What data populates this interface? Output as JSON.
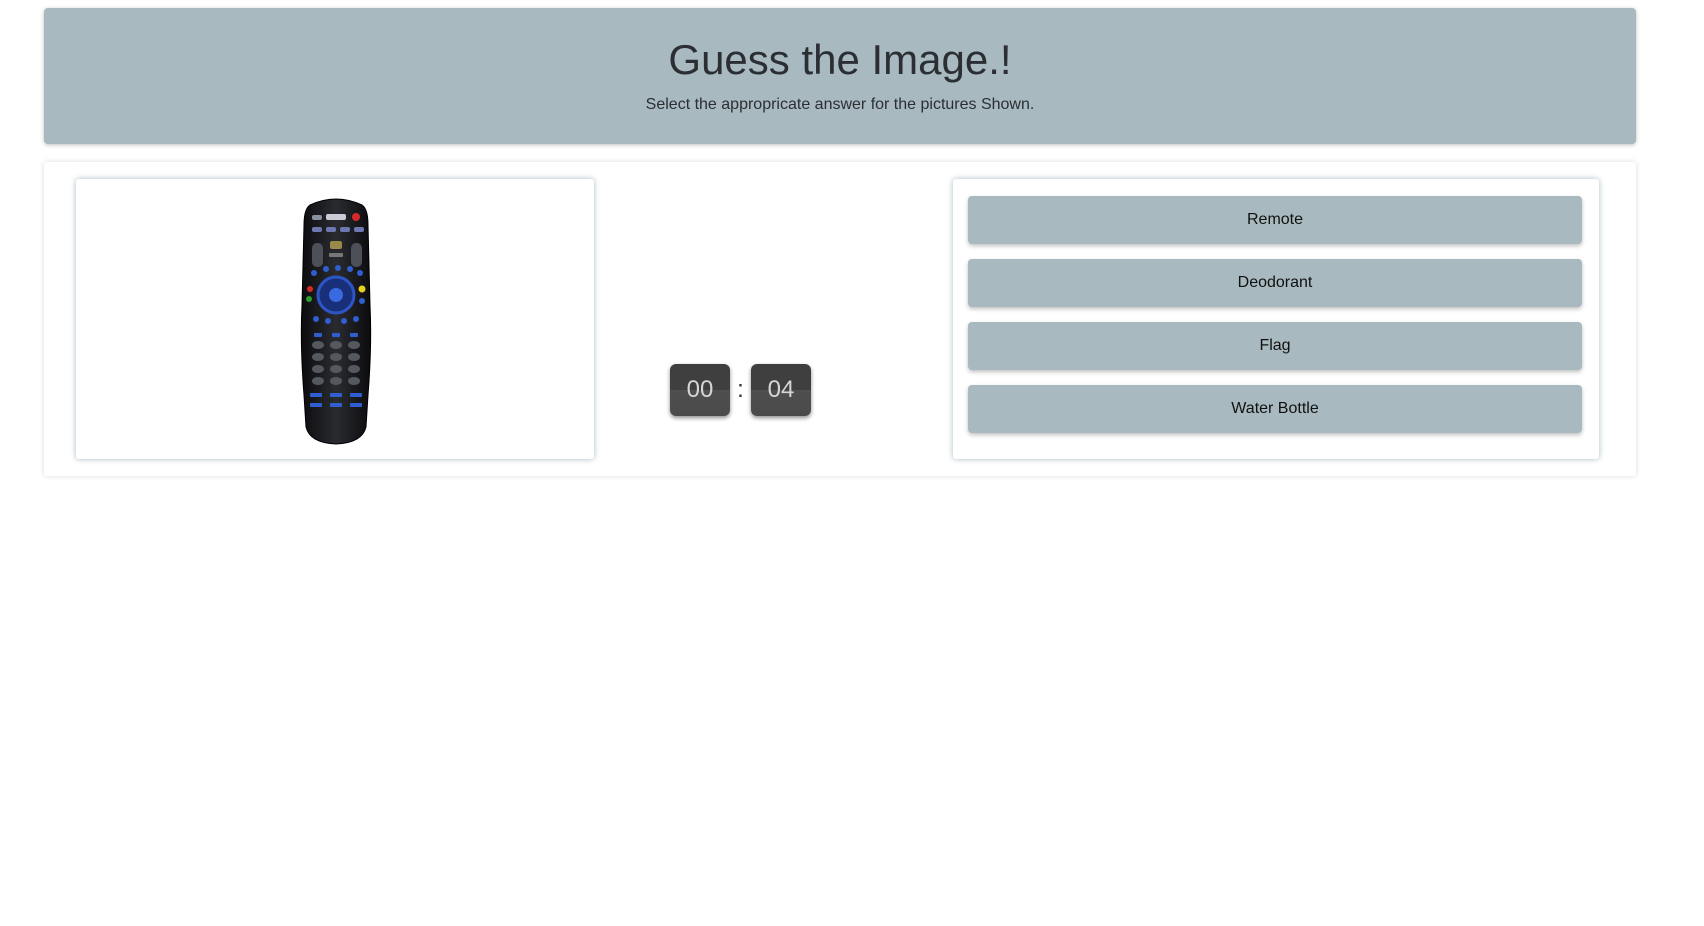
{
  "header": {
    "title": "Guess the Image.!",
    "subtitle": "Select the appropricate answer for the pictures Shown."
  },
  "question": {
    "image_alt": "TV remote control",
    "image_icon": "remote-control-icon"
  },
  "timer": {
    "minutes": "00",
    "separator": ":",
    "seconds": "04"
  },
  "answers": [
    {
      "label": "Remote"
    },
    {
      "label": "Deodorant"
    },
    {
      "label": "Flag"
    },
    {
      "label": "Water Bottle"
    }
  ],
  "colors": {
    "header_bg": "#a8babf",
    "button_bg": "#a8babf",
    "timer_bg": "#3f3f3f",
    "timer_text": "#d6d6d6"
  }
}
